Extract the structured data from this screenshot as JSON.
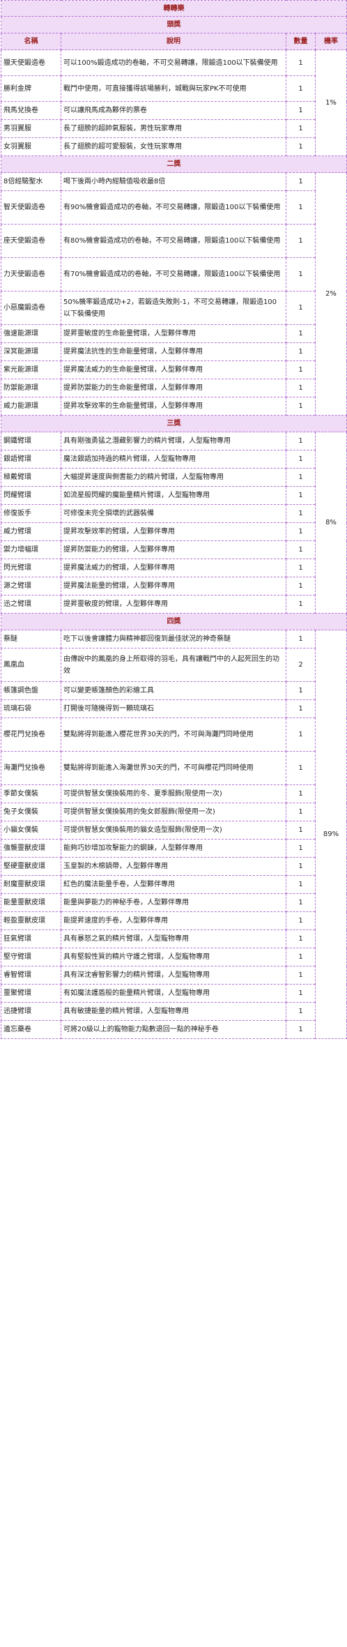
{
  "title": "轉轉樂",
  "headers": {
    "name": "名稱",
    "desc": "說明",
    "qty": "數量",
    "rate": "機率"
  },
  "sections": [
    {
      "label": "頭獎",
      "rate": "1%",
      "rows": [
        {
          "name": "獵天使鍛造卷",
          "desc": "可以100%鍛造成功的卷軸，不可交易轉讓，限鍛造100以下裝備使用",
          "qty": "1"
        },
        {
          "name": "勝利金牌",
          "desc": "戰鬥中使用，可直接獲得該場勝利，城戰與玩家PK不可使用",
          "qty": "1"
        },
        {
          "name": "飛馬兌換卷",
          "desc": "可以讓飛馬成為夥伴的票卷",
          "qty": "1"
        },
        {
          "name": "男羽翼服",
          "desc": "長了翅膀的超帥氣服裝，男性玩家專用",
          "qty": "1"
        },
        {
          "name": "女羽翼服",
          "desc": "長了翅膀的超可愛服裝，女性玩家專用",
          "qty": "1"
        }
      ]
    },
    {
      "label": "二獎",
      "rate": "2%",
      "rows": [
        {
          "name": "8倍經驗聖水",
          "desc": "喝下後兩小時內經驗值吸收最8倍",
          "qty": "1"
        },
        {
          "name": "智天使鍛造卷",
          "desc": "有90%機會鍛造成功的卷軸，不可交易轉讓，限鍛造100以下裝備使用",
          "qty": "1"
        },
        {
          "name": "座天使鍛造卷",
          "desc": "有80%機會鍛造成功的卷軸，不可交易轉讓，限鍛造100以下裝備使用",
          "qty": "1"
        },
        {
          "name": "力天使鍛造卷",
          "desc": "有70%機會鍛造成功的卷軸，不可交易轉讓，限鍛造100以下裝備使用",
          "qty": "1"
        },
        {
          "name": "小惡魔鍛造卷",
          "desc": "50%機率鍛造成功+2，若鍛造失敗則-1，不可交易轉讓，限鍛造100以下裝備使用",
          "qty": "1"
        },
        {
          "name": "強速能源環",
          "desc": "提昇靈敏度的生命能量臂環，人型夥伴專用",
          "qty": "1"
        },
        {
          "name": "深冥能源環",
          "desc": "提昇魔法抗性的生命能量臂環，人型夥伴專用",
          "qty": "1"
        },
        {
          "name": "紫光能源環",
          "desc": "提昇魔法威力的生命能量臂環，人型夥伴專用",
          "qty": "1"
        },
        {
          "name": "防禦能源環",
          "desc": "提昇防禦能力的生命能量臂環，人型夥伴專用",
          "qty": "1"
        },
        {
          "name": "威力能源環",
          "desc": "提昇攻擊效率的生命能量臂環，人型夥伴專用",
          "qty": "1"
        }
      ]
    },
    {
      "label": "三獎",
      "rate": "8%",
      "rows": [
        {
          "name": "鋼鐵臂環",
          "desc": "具有剛強勇猛之潛藏影響力的精片臂環，人型寵物專用",
          "qty": "1"
        },
        {
          "name": "銀語臂環",
          "desc": "魔法銀語加持過的精片臂環，人型寵物專用",
          "qty": "1"
        },
        {
          "name": "極戴臂環",
          "desc": "大幅提昇速度與側耆能力的精片臂環，人型寵物專用",
          "qty": "1"
        },
        {
          "name": "閃耀臂環",
          "desc": "如流星般閃耀的魔能量精片臂環，人型寵物專用",
          "qty": "1"
        },
        {
          "name": "修復扳手",
          "desc": "可修復未完全損壞的武器裝備",
          "qty": "1"
        },
        {
          "name": "威力臂環",
          "desc": "提昇攻擊效率的臂環，人型夥伴專用",
          "qty": "1"
        },
        {
          "name": "禦力增幅環",
          "desc": "提昇防禦能力的臂環，人型夥伴專用",
          "qty": "1"
        },
        {
          "name": "閃光臂環",
          "desc": "提昇魔法威力的臂環，人型夥伴專用",
          "qty": "1"
        },
        {
          "name": "源之臂環",
          "desc": "提昇魔法能量的臂環，人型夥伴專用",
          "qty": "1"
        },
        {
          "name": "迅之臂環",
          "desc": "提昇靈敏度的臂環，人型夥伴專用",
          "qty": "1"
        }
      ]
    },
    {
      "label": "四獎",
      "rate": "89%",
      "rows": [
        {
          "name": "蔡醚",
          "desc": "吃下以後會讓體力與精神都回復到最佳狀況的神奇蔡醚",
          "qty": "1"
        },
        {
          "name": "鳳凰血",
          "desc": "由傳說中的鳳凰的身上所取得的羽毛，具有讓戰鬥中的人起死回生的功效",
          "qty": "2"
        },
        {
          "name": "帳篷調色盤",
          "desc": "可以變更帳篷顏色的彩繪工具",
          "qty": "1"
        },
        {
          "name": "琉璃石袋",
          "desc": "打開後可隨機得到一顆琉璃石",
          "qty": "1"
        },
        {
          "name": "櫻花門兌換卷",
          "desc": "雙點將得到能進入櫻花世界30天的門，不可與海灘門同時使用",
          "qty": "1"
        },
        {
          "name": "海灘門兌換卷",
          "desc": "雙點將得到能進入海灘世界30天的門，不可與櫻花門同時使用",
          "qty": "1"
        },
        {
          "name": "季節女僕裝",
          "desc": "可提供智慧女僕換裝用的冬、夏季服飾(限使用一次)",
          "qty": "1"
        },
        {
          "name": "兔子女僕裝",
          "desc": "可提供智慧女僕換裝用的兔女郎服飾(限使用一次)",
          "qty": "1"
        },
        {
          "name": "小貓女僕裝",
          "desc": "可提供智慧女僕換裝用的貓女造型服飾(限使用一次)",
          "qty": "1"
        },
        {
          "name": "強襲靈獸皮環",
          "desc": "能夠巧妙增加攻擊能力的鋼鍊，人型夥伴專用",
          "qty": "1"
        },
        {
          "name": "堅硬靈獸皮環",
          "desc": "玉皇製的木棉鍋帶，人型夥伴專用",
          "qty": "1"
        },
        {
          "name": "耐魔靈獸皮環",
          "desc": "紅色的魔法能量手卷，人型夥伴專用",
          "qty": "1"
        },
        {
          "name": "能量靈獸皮環",
          "desc": "能量與夢能力的神秘手卷，人型夥伴專用",
          "qty": "1"
        },
        {
          "name": "輕盈靈獸皮環",
          "desc": "能提昇速度的手卷，人型夥伴專用",
          "qty": "1"
        },
        {
          "name": "狂氣臂環",
          "desc": "具有暴怒之氣的精片臂環，人型寵物專用",
          "qty": "1"
        },
        {
          "name": "堅守臂環",
          "desc": "具有堅毅性質的精片守護之臂環，人型寵物專用",
          "qty": "1"
        },
        {
          "name": "睿智臂環",
          "desc": "具有深沈睿智影響力的精片臂環，人型寵物專用",
          "qty": "1"
        },
        {
          "name": "靈聚臂環",
          "desc": "有如魔法護盾般的能量精片臂環，人型寵物專用",
          "qty": "1"
        },
        {
          "name": "迅捷臂環",
          "desc": "具有敏捷能量的精片臂環，人型寵物專用",
          "qty": "1"
        },
        {
          "name": "遺忘藥卷",
          "desc": "可將20級以上的寵物能力點數退回一點的神秘手卷",
          "qty": "1"
        }
      ]
    }
  ]
}
